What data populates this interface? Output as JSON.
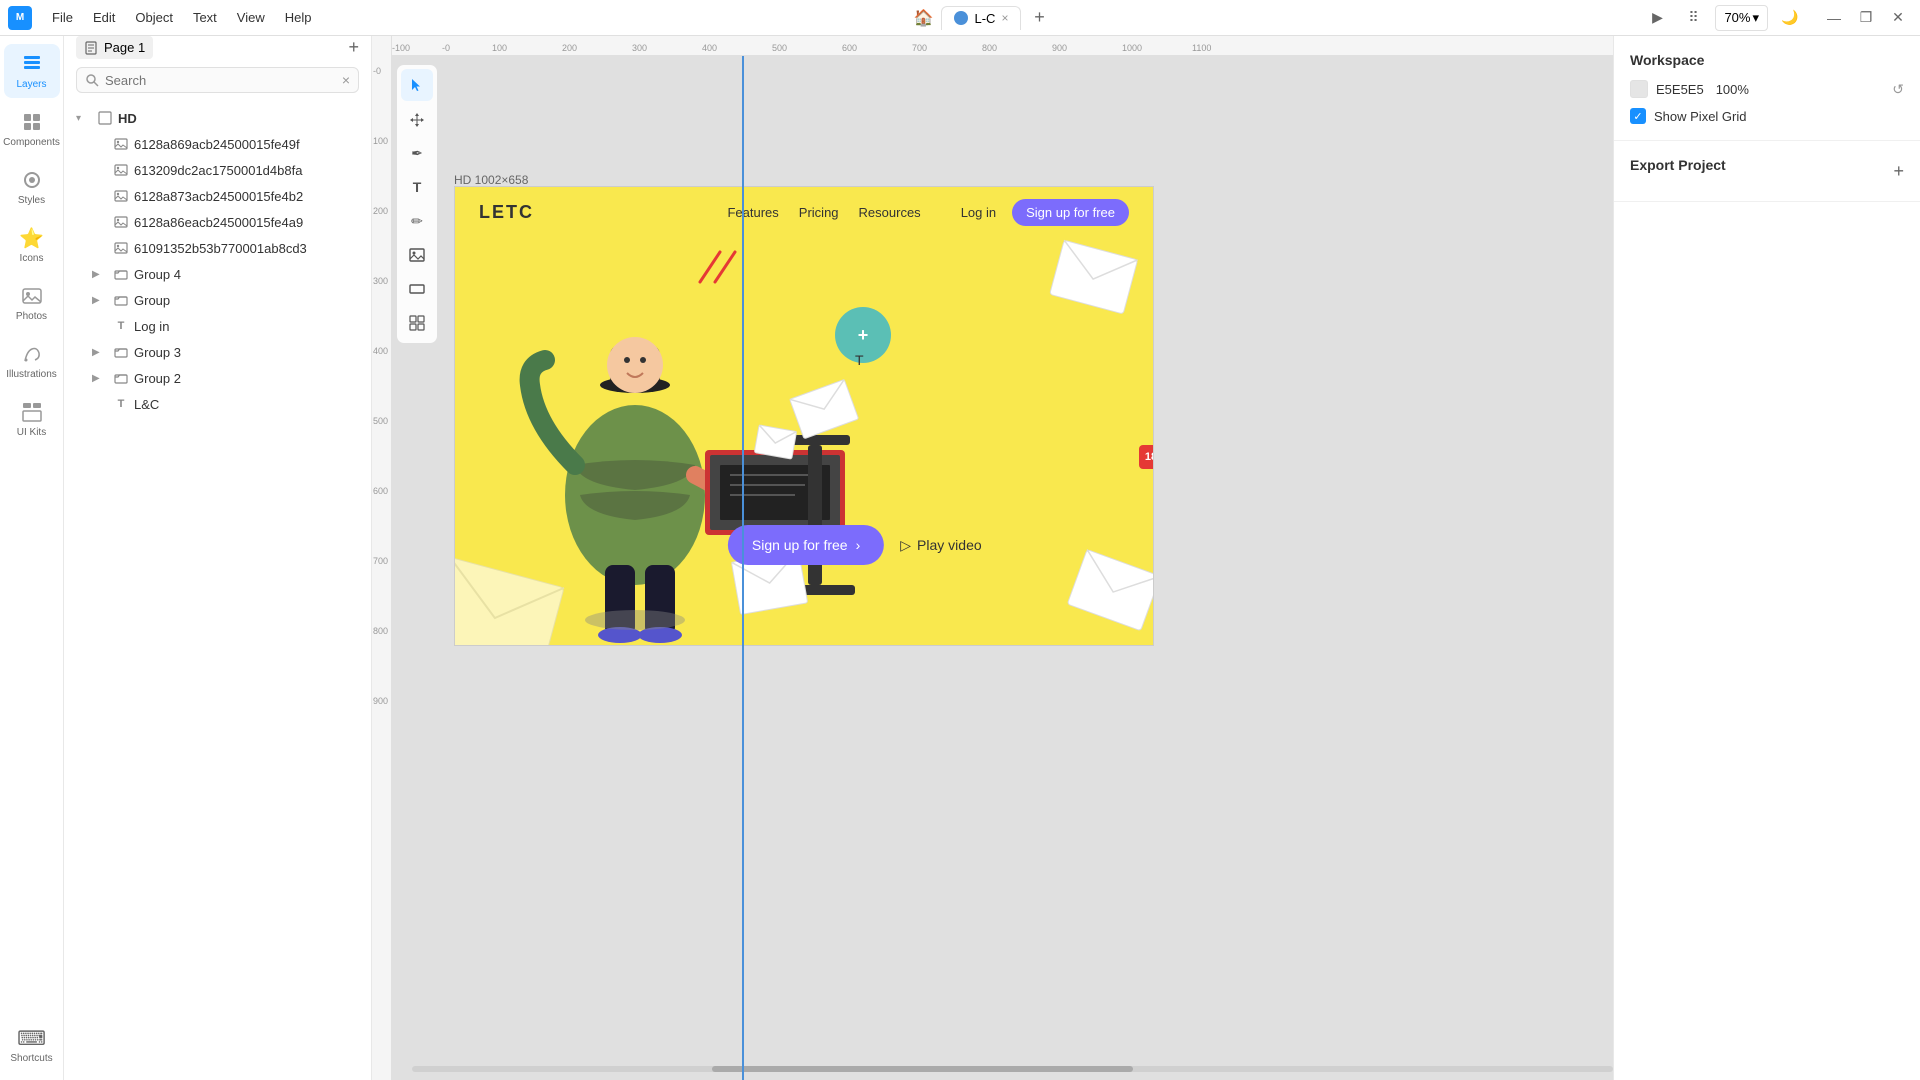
{
  "titleBar": {
    "logoText": "M",
    "menus": [
      "File",
      "Edit",
      "Object",
      "Text",
      "View",
      "Help"
    ],
    "homeTab": "🏠",
    "tab": {
      "icon": "page-icon",
      "label": "L-C",
      "close": "×"
    },
    "tabAdd": "+",
    "zoom": "70%",
    "zoomChevron": "▾",
    "playBtn": "▶",
    "gridBtn": "⠿",
    "moonBtn": "🌙",
    "minimizeBtn": "—",
    "restoreBtn": "❐",
    "closeBtn": "✕"
  },
  "sidebar": {
    "items": [
      {
        "id": "layers",
        "label": "Layers",
        "icon": "⧉"
      },
      {
        "id": "components",
        "label": "Components",
        "icon": "◫"
      },
      {
        "id": "styles",
        "label": "Styles",
        "icon": "◉"
      },
      {
        "id": "icons",
        "label": "Icons",
        "icon": "★"
      },
      {
        "id": "photos",
        "label": "Photos",
        "icon": "🖼"
      },
      {
        "id": "illustrations",
        "label": "Illustrations",
        "icon": "✏"
      },
      {
        "id": "uikits",
        "label": "UI Kits",
        "icon": "⊞"
      },
      {
        "id": "shortcuts",
        "label": "Shortcuts",
        "icon": "⌨"
      }
    ]
  },
  "layersPanel": {
    "pageLabel": "Page 1",
    "pageAddBtn": "+",
    "search": {
      "placeholder": "Search",
      "closeBtn": "×"
    },
    "tree": [
      {
        "id": "hd",
        "level": 0,
        "type": "frame",
        "name": "HD",
        "hasChevron": true,
        "chevron": "▾"
      },
      {
        "id": "img1",
        "level": 1,
        "type": "image",
        "name": "6128a869acb24500015fe49f"
      },
      {
        "id": "img2",
        "level": 1,
        "type": "image",
        "name": "613209dc2ac1750001d4b8fa"
      },
      {
        "id": "img3",
        "level": 1,
        "type": "image",
        "name": "6128a873acb24500015fe4b2"
      },
      {
        "id": "img4",
        "level": 1,
        "type": "image",
        "name": "6128a86eacb24500015fe4a9"
      },
      {
        "id": "img5",
        "level": 1,
        "type": "image",
        "name": "61091352b53b770001ab8cd3"
      },
      {
        "id": "group4",
        "level": 1,
        "type": "group",
        "name": "Group 4",
        "hasChevron": true,
        "chevron": "▶"
      },
      {
        "id": "group",
        "level": 1,
        "type": "group",
        "name": "Group",
        "hasChevron": true,
        "chevron": "▶"
      },
      {
        "id": "login",
        "level": 1,
        "type": "text",
        "name": "Log in"
      },
      {
        "id": "group3",
        "level": 1,
        "type": "group",
        "name": "Group 3",
        "hasChevron": true,
        "chevron": "▶"
      },
      {
        "id": "group2",
        "level": 1,
        "type": "group",
        "name": "Group 2",
        "hasChevron": true,
        "chevron": "▶"
      },
      {
        "id": "lc",
        "level": 1,
        "type": "text",
        "name": "L&C"
      }
    ]
  },
  "tools": [
    {
      "id": "select",
      "icon": "↖",
      "active": true
    },
    {
      "id": "move",
      "icon": "✥",
      "active": false
    },
    {
      "id": "pen",
      "icon": "✒",
      "active": false
    },
    {
      "id": "text",
      "icon": "T",
      "active": false
    },
    {
      "id": "pencil",
      "icon": "✏",
      "active": false
    },
    {
      "id": "image",
      "icon": "▣",
      "active": false
    },
    {
      "id": "rect",
      "icon": "▬",
      "active": false
    },
    {
      "id": "grid",
      "icon": "⊞",
      "active": false
    }
  ],
  "canvas": {
    "frameLabel": "HD  1002×658",
    "rulerMarks": [
      "-100",
      "-0",
      "100",
      "200",
      "300",
      "400",
      "500",
      "600",
      "700",
      "800",
      "900",
      "1000",
      "1100"
    ],
    "rulerMarksV": [
      "-0",
      "100",
      "200",
      "300",
      "400",
      "500",
      "600",
      "700",
      "800",
      "900"
    ]
  },
  "frameContent": {
    "logo": "LETC",
    "navLinks": [
      "Features",
      "Pricing",
      "Resources"
    ],
    "login": "Log in",
    "signup": "Sign up for free",
    "ctaBtn": "Sign up for free",
    "ctaChevron": "›",
    "playVideo": "Play video"
  },
  "rightPanel": {
    "workspaceTitle": "Workspace",
    "colorValue": "E5E5E5",
    "opacity": "100%",
    "showPixelGrid": "Show Pixel Grid",
    "exportProject": "Export Project",
    "exportAdd": "+"
  }
}
